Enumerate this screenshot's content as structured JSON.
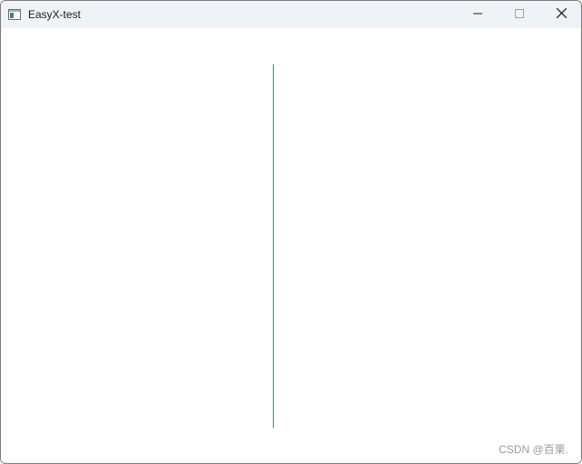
{
  "window": {
    "title": "EasyX-test",
    "app_icon": "window-app-icon",
    "controls": {
      "minimize_icon": "minimize-icon",
      "maximize_icon": "maximize-icon",
      "close_icon": "close-icon"
    }
  },
  "canvas": {
    "line_color": "#3f86a6"
  },
  "watermark": {
    "text": "CSDN @百栗."
  }
}
